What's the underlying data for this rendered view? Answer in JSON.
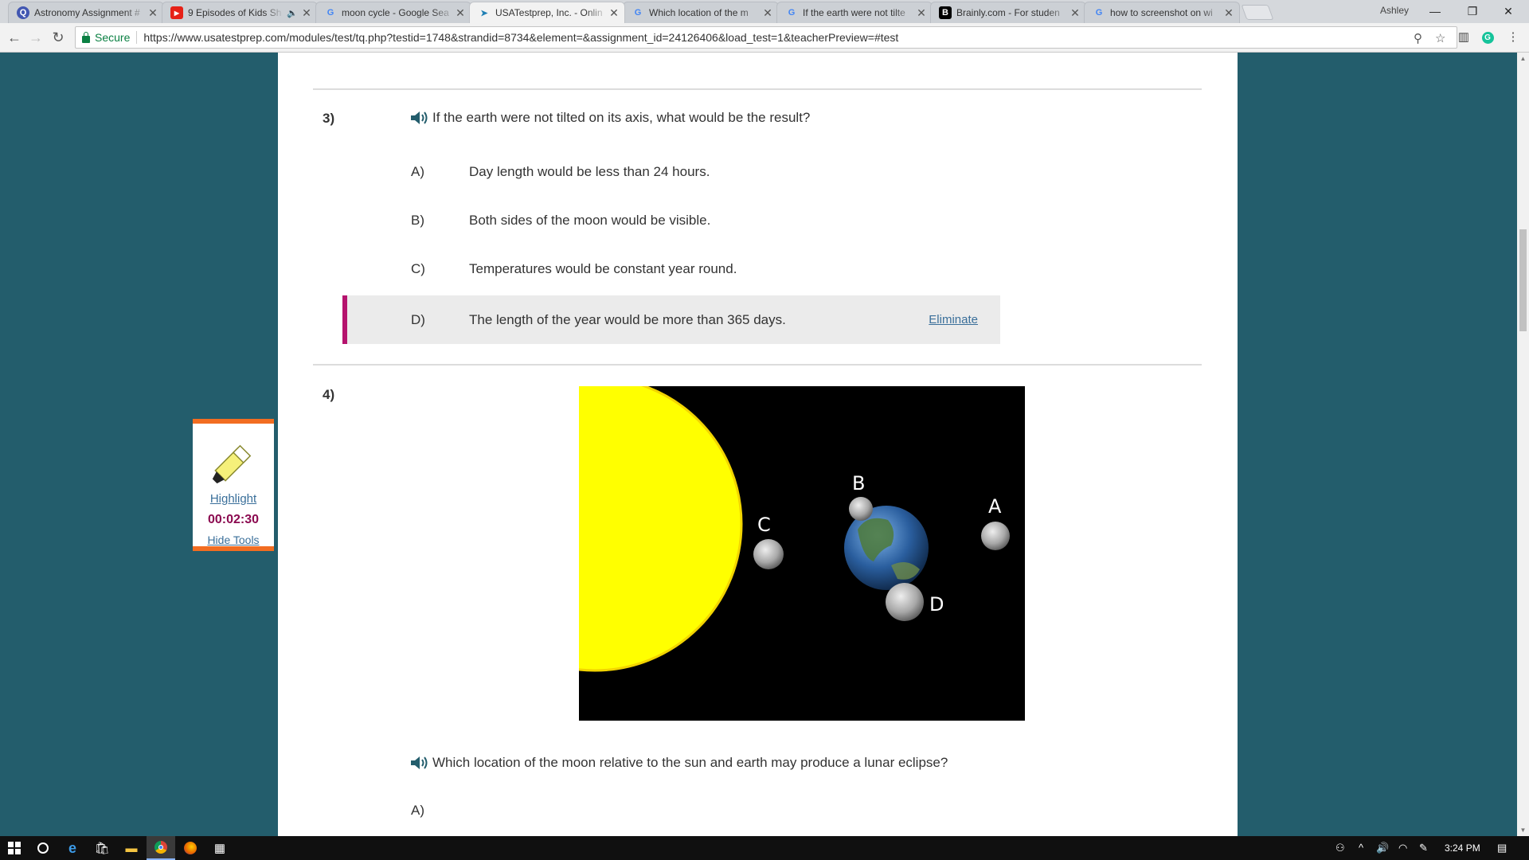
{
  "browser": {
    "tabs": [
      {
        "title": "Astronomy Assignment #",
        "favicon": "quizlet-icon",
        "active": false
      },
      {
        "title": "9 Episodes of Kids Sh",
        "favicon": "youtube-icon",
        "active": false,
        "audio": true
      },
      {
        "title": "moon cycle - Google Sea",
        "favicon": "google-icon",
        "active": false
      },
      {
        "title": "USATestprep, Inc. - Onlin",
        "favicon": "cursor-icon",
        "active": true
      },
      {
        "title": "Which location of the m",
        "favicon": "google-icon",
        "active": false
      },
      {
        "title": "If the earth were not tilte",
        "favicon": "google-icon",
        "active": false
      },
      {
        "title": "Brainly.com - For studen",
        "favicon": "brainly-icon",
        "active": false
      },
      {
        "title": "how to screenshot on wi",
        "favicon": "google-icon",
        "active": false
      }
    ],
    "profile_name": "Ashley",
    "secure_label": "Secure",
    "url": "https://www.usatestprep.com/modules/test/tq.php?testid=1748&strandid=8734&element=&assignment_id=24126406&load_test=1&teacherPreview=#test"
  },
  "page": {
    "question3": {
      "number": "3)",
      "text": "If the earth were not tilted on its axis, what would be the result?",
      "options": [
        {
          "letter": "A)",
          "text": "Day length would be less than 24 hours."
        },
        {
          "letter": "B)",
          "text": "Both sides of the moon would be visible."
        },
        {
          "letter": "C)",
          "text": "Temperatures would be constant year round."
        },
        {
          "letter": "D)",
          "text": "The length of the year would be more than 365 days."
        }
      ],
      "eliminate_label": "Eliminate"
    },
    "question4": {
      "number": "4)",
      "figure_labels": {
        "a": "A",
        "b": "B",
        "c": "C",
        "d": "D"
      },
      "text": "Which location of the moon relative to the sun and earth may produce a lunar eclipse?",
      "options": [
        {
          "letter": "A)"
        }
      ]
    },
    "tools": {
      "highlight_label": "Highlight",
      "timer": "00:02:30",
      "hide_label": "Hide Tools"
    }
  },
  "taskbar": {
    "clock": "3:24 PM"
  },
  "colors": {
    "page_background": "#235d6c",
    "accent_orange": "#f26d21",
    "hover_bar": "#b5136e",
    "timer": "#8b0a50",
    "link": "#3a6f9a"
  }
}
